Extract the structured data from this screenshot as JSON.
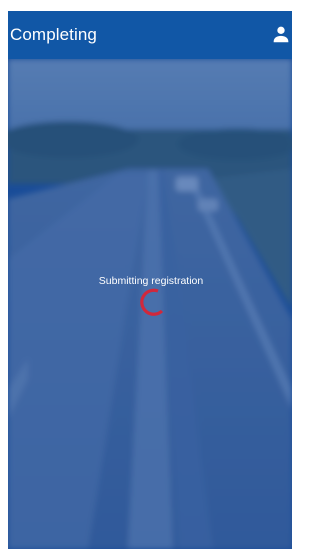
{
  "app_bar": {
    "title": "Completing",
    "account_icon": "person-icon"
  },
  "background": {
    "description_icon": "highway-photo"
  },
  "loader": {
    "status_text": "Submitting registration",
    "spinner_color": "#d0283c"
  },
  "colors": {
    "app_bar": "#1157a6",
    "overlay": "#1a4da0",
    "text": "#ffffff"
  }
}
